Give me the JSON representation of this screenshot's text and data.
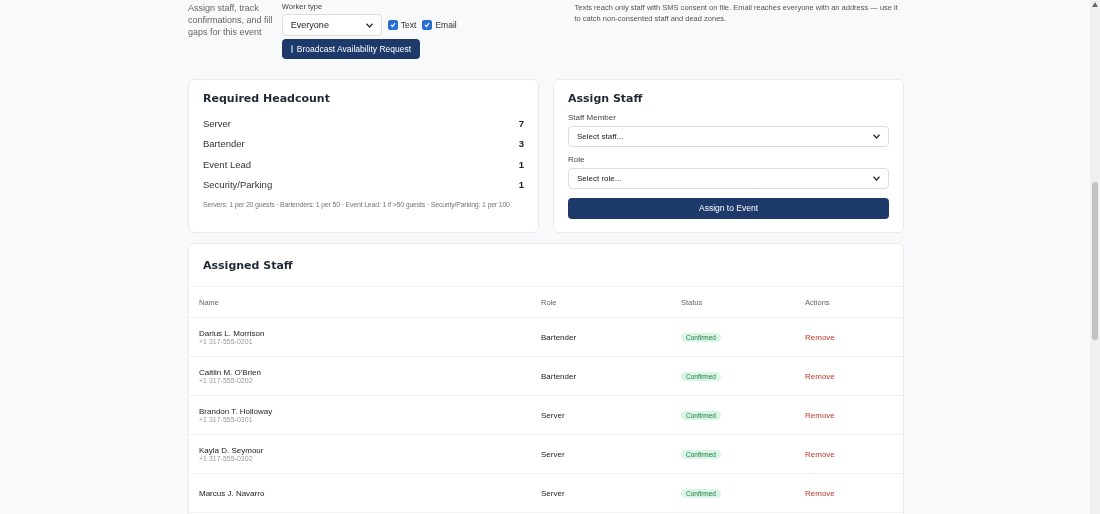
{
  "intro": {
    "description": "Assign staff, track confirmations, and fill gaps for this event"
  },
  "broadcast": {
    "worker_type_label": "Worker type",
    "worker_type_value": "Everyone",
    "channels": [
      {
        "label": "Text",
        "checked": true
      },
      {
        "label": "Email",
        "checked": true
      }
    ],
    "button": "Broadcast Availability Request",
    "note": "Texts reach only staff with SMS consent on file. Email reaches everyone with an address — use it to catch non-consented staff and dead zones."
  },
  "headcount": {
    "title": "Required Headcount",
    "rows": [
      {
        "role": "Server",
        "count": "7"
      },
      {
        "role": "Bartender",
        "count": "3"
      },
      {
        "role": "Event Lead",
        "count": "1"
      },
      {
        "role": "Security/Parking",
        "count": "1"
      }
    ],
    "footnote": "Servers: 1 per 20 guests · Bartenders: 1 per 50 · Event Lead: 1 if >50 guests · Security/Parking: 1 per 100"
  },
  "assign": {
    "title": "Assign Staff",
    "staff_label": "Staff Member",
    "staff_placeholder": "Select staff...",
    "role_label": "Role",
    "role_placeholder": "Select role...",
    "button": "Assign to Event"
  },
  "assigned": {
    "title": "Assigned Staff",
    "columns": [
      "Name",
      "Role",
      "Status",
      "Actions"
    ],
    "rows": [
      {
        "name": "Darius L. Morrison",
        "phone": "+1 317-555-0201",
        "role": "Bartender",
        "status": "Confirmed",
        "action": "Remove"
      },
      {
        "name": "Caitlin M. O'Brien",
        "phone": "+1 317-555-0202",
        "role": "Bartender",
        "status": "Confirmed",
        "action": "Remove"
      },
      {
        "name": "Brandon T. Holloway",
        "phone": "+1 317-555-0301",
        "role": "Server",
        "status": "Confirmed",
        "action": "Remove"
      },
      {
        "name": "Kayla D. Seymour",
        "phone": "+1 317-555-0302",
        "role": "Server",
        "status": "Confirmed",
        "action": "Remove"
      },
      {
        "name": "Marcus J. Navarro",
        "role": "Server",
        "status": "Confirmed",
        "action": "Remove"
      }
    ]
  }
}
